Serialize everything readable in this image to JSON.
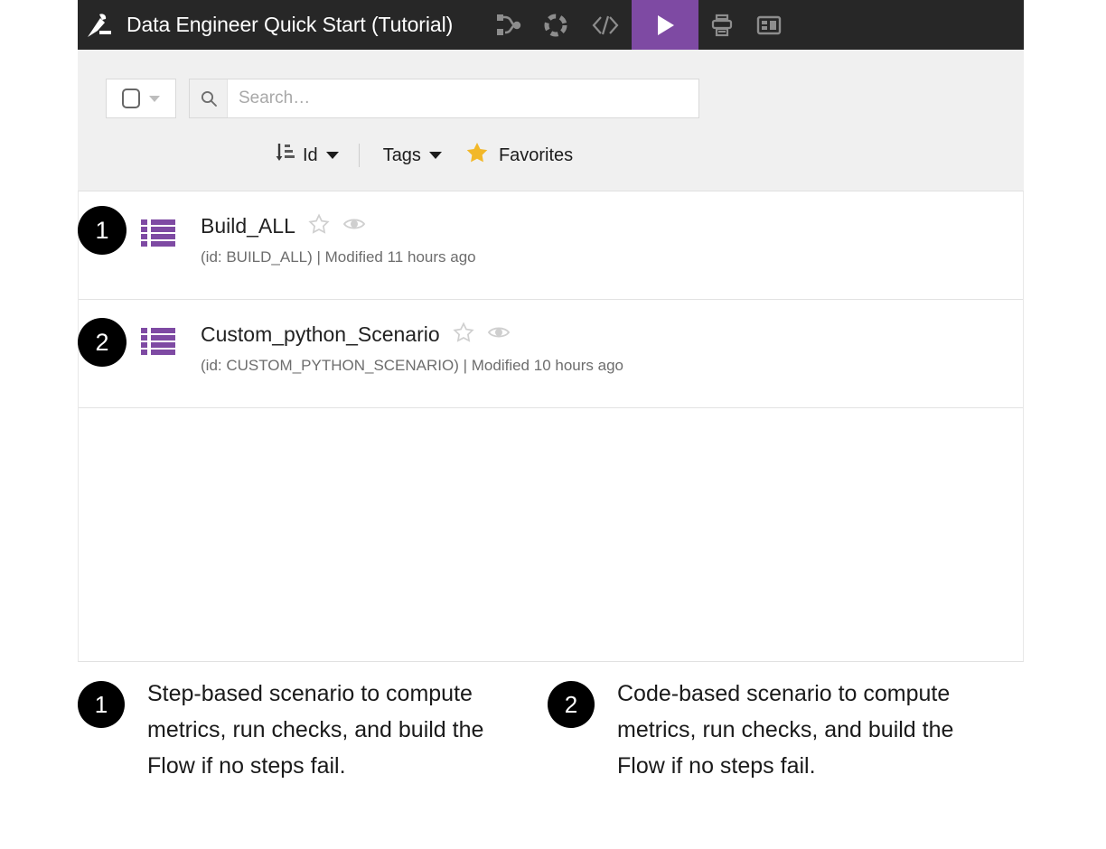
{
  "app": {
    "title": "Data Engineer Quick Start (Tutorial)",
    "logo_icon": "dataiku-bird-logo",
    "accent_color": "#7e4aa3",
    "topbar_color": "#272727"
  },
  "topbar_icons": [
    {
      "name": "flow-icon",
      "label": "Flow"
    },
    {
      "name": "gear-dashed-icon",
      "label": "Settings"
    },
    {
      "name": "code-icon",
      "label": "Code"
    },
    {
      "name": "run-play-icon",
      "label": "Run",
      "active": true
    },
    {
      "name": "print-icon",
      "label": "Print"
    },
    {
      "name": "layout-panel-icon",
      "label": "Layout"
    }
  ],
  "search": {
    "placeholder": "Search…",
    "value": "",
    "search_icon": "magnifier-icon",
    "checkbox_icon": "checkbox-unchecked-icon",
    "dropdown_icon": "chevron-down-icon"
  },
  "filters": {
    "sort_icon": "sort-descending-icon",
    "sort_label": "Id",
    "tags_label": "Tags",
    "favorites_label": "Favorites",
    "favorites_icon": "star-filled-icon",
    "favorites_color": "#f2b829"
  },
  "list": {
    "rows": [
      {
        "badge": "1",
        "icon": "scenario-steps-icon",
        "title": "Build_ALL",
        "star_icon": "star-outline-icon",
        "watch_icon": "eye-icon",
        "subtitle": "(id: BUILD_ALL) | Modified 11 hours ago"
      },
      {
        "badge": "2",
        "icon": "scenario-steps-icon",
        "title": "Custom_python_Scenario",
        "star_icon": "star-outline-icon",
        "watch_icon": "eye-icon",
        "subtitle": "(id: CUSTOM_PYTHON_SCENARIO) | Modified 10 hours ago"
      }
    ]
  },
  "captions": [
    {
      "badge": "1",
      "text": "Step-based scenario to compute metrics, run checks, and build the Flow if no steps fail."
    },
    {
      "badge": "2",
      "text": "Code-based scenario to compute metrics, run checks, and build the Flow if no steps fail."
    }
  ]
}
